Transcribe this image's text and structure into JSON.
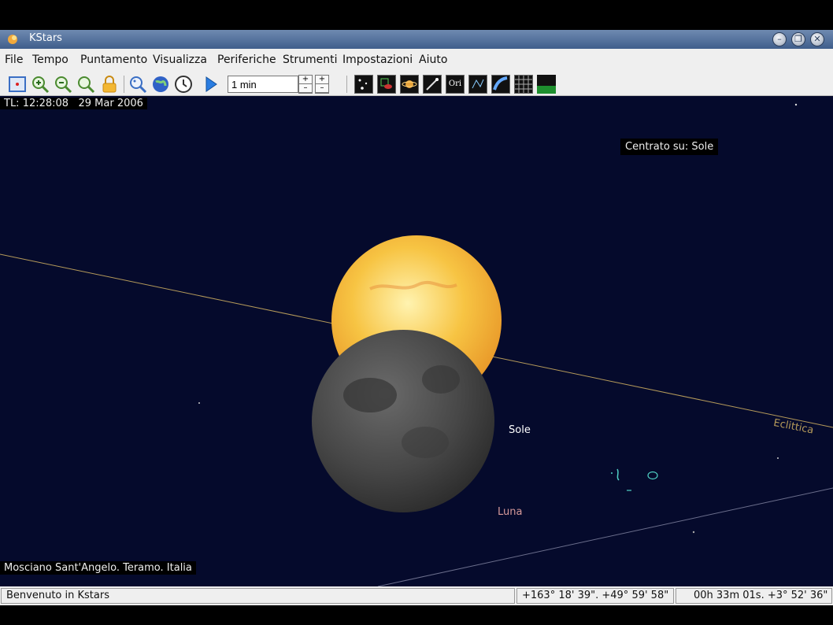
{
  "window": {
    "title": "KStars"
  },
  "menu": {
    "items": [
      {
        "label": "File"
      },
      {
        "label": "Tempo"
      },
      {
        "label": "Puntamento"
      },
      {
        "label": "Visualizza"
      },
      {
        "label": "Periferiche"
      },
      {
        "label": "Strumenti"
      },
      {
        "label": "Impostazioni"
      },
      {
        "label": "Aiuto"
      }
    ]
  },
  "toolbar": {
    "time_step": "1 min",
    "icons": [
      "center-icon",
      "zoom-in-icon",
      "zoom-out-icon",
      "zoom-default-icon",
      "lock-icon",
      "find-icon",
      "globe-icon",
      "clock-icon",
      "play-icon"
    ],
    "view_toggles": [
      "stars-icon",
      "deep-sky-icon",
      "planets-icon",
      "comets-icon",
      "constellation-names-icon",
      "constellation-lines-icon",
      "milky-way-icon",
      "grid-icon",
      "ground-icon"
    ],
    "ori_label": "Ori"
  },
  "sky": {
    "local_time": "TL: 12:28:08",
    "date": "29 Mar 2006",
    "centered_on": "Centrato su: Sole",
    "sun_label": "Sole",
    "moon_label": "Luna",
    "ecliptic_label": "Eclittica",
    "location": "Mosciano Sant'Angelo. Teramo.  Italia",
    "colors": {
      "background": "#050a2c",
      "ecliptic": "#b59a5a",
      "moon_label": "#d79a9a",
      "sun": "#f7c443",
      "moon": "#4a4a4a"
    }
  },
  "status": {
    "message": "Benvenuto in Kstars",
    "az_alt": "+163° 18' 39\".  +49° 59' 58\"",
    "ra_dec": "00h 33m 01s.  +3° 52' 36\""
  }
}
